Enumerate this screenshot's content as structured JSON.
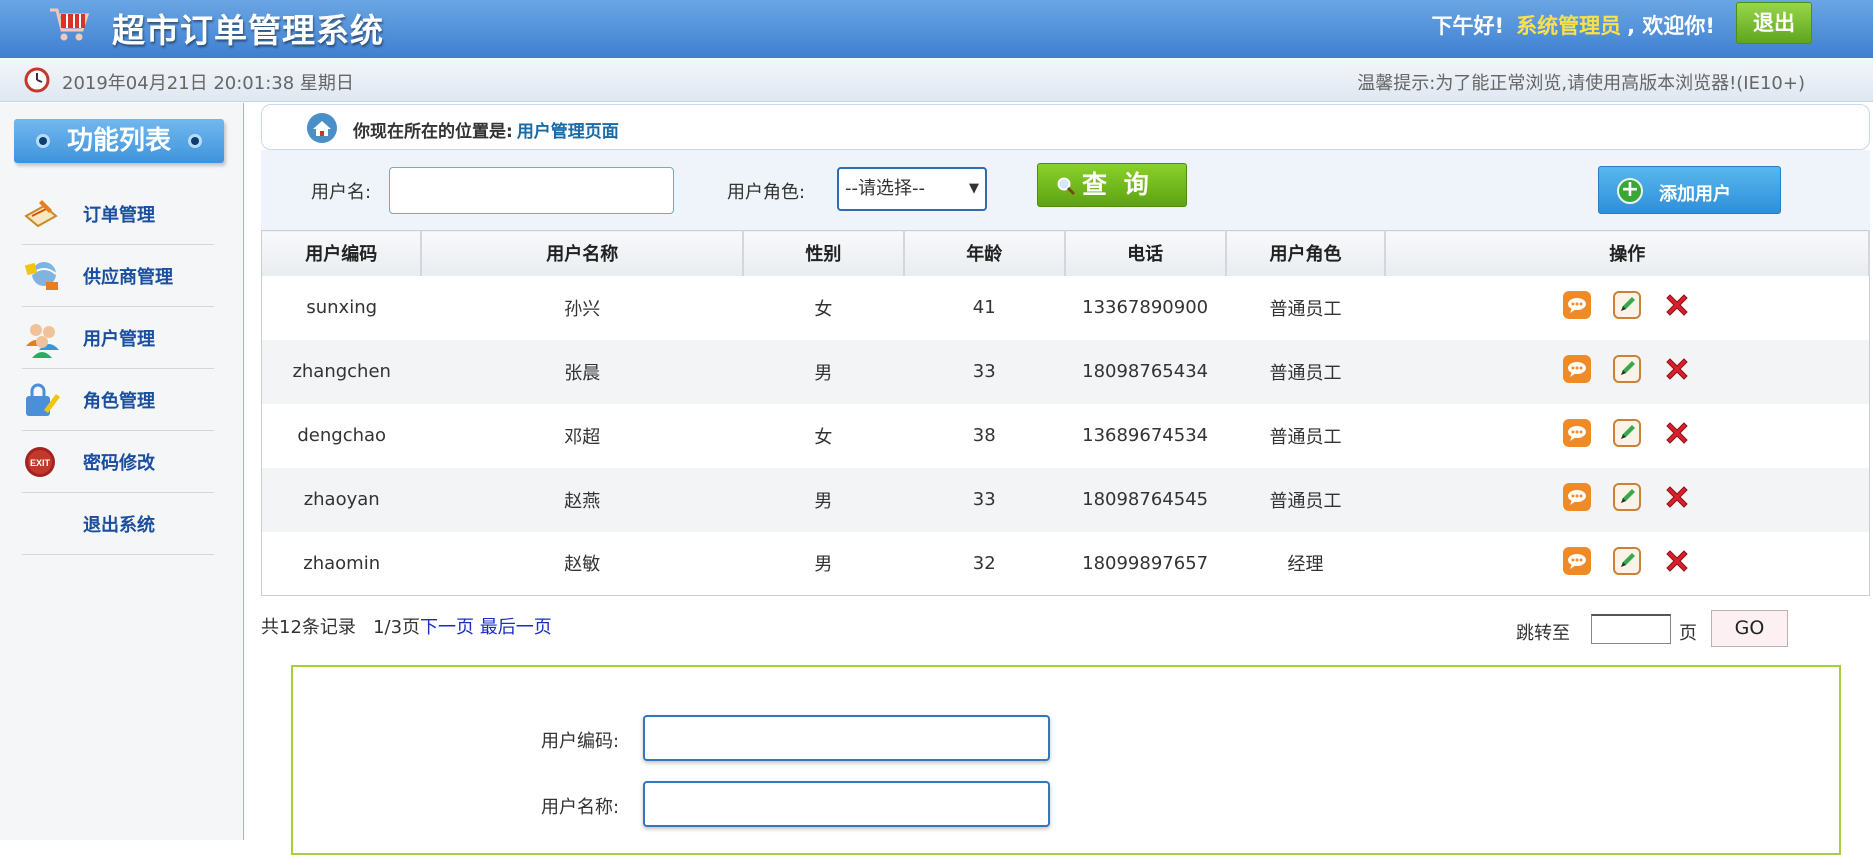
{
  "header": {
    "app_title": "超市订单管理系统",
    "greeting_prefix": "下午好!",
    "role": "系统管理员",
    "greeting_suffix": ", 欢迎你!",
    "logout": "退出"
  },
  "subbar": {
    "datetime": "2019年04月21日 20:01:38 星期日",
    "tip": "温馨提示:为了能正常浏览,请使用高版本浏览器!(IE10+)"
  },
  "sidebar": {
    "title": "功能列表",
    "items": [
      {
        "label": "订单管理",
        "icon": "order-icon"
      },
      {
        "label": "供应商管理",
        "icon": "supplier-icon"
      },
      {
        "label": "用户管理",
        "icon": "users-icon"
      },
      {
        "label": "角色管理",
        "icon": "role-icon"
      },
      {
        "label": "密码修改",
        "icon": "exit-badge-icon"
      },
      {
        "label": "退出系统",
        "icon": ""
      }
    ]
  },
  "breadcrumb": {
    "prefix": "你现在所在的位置是:",
    "page": "用户管理页面"
  },
  "search": {
    "username_label": "用户名:",
    "username_value": "",
    "role_label": "用户角色:",
    "role_selected": "--请选择--",
    "query_button": "查 询",
    "add_button": "添加用户"
  },
  "table": {
    "columns": [
      "用户编码",
      "用户名称",
      "性别",
      "年龄",
      "电话",
      "用户角色",
      "操作"
    ],
    "rows": [
      {
        "code": "sunxing",
        "name": "孙兴",
        "gender": "女",
        "age": "41",
        "phone": "13367890900",
        "role": "普通员工"
      },
      {
        "code": "zhangchen",
        "name": "张晨",
        "gender": "男",
        "age": "33",
        "phone": "18098765434",
        "role": "普通员工"
      },
      {
        "code": "dengchao",
        "name": "邓超",
        "gender": "女",
        "age": "38",
        "phone": "13689674534",
        "role": "普通员工"
      },
      {
        "code": "zhaoyan",
        "name": "赵燕",
        "gender": "男",
        "age": "33",
        "phone": "18098764545",
        "role": "普通员工"
      },
      {
        "code": "zhaomin",
        "name": "赵敏",
        "gender": "男",
        "age": "32",
        "phone": "18099897657",
        "role": "经理"
      }
    ]
  },
  "pager": {
    "total": "共12条记录",
    "current": "1/3页",
    "next": "下一页",
    "last": "最后一页",
    "jump_label": "跳转至",
    "jump_value": "",
    "page_unit": "页",
    "go": "GO"
  },
  "form": {
    "code_label": "用户编码:",
    "code_value": "",
    "name_label": "用户名称:",
    "name_value": ""
  },
  "colors": {
    "header_top": "#6aa6e4",
    "header_bottom": "#3f7fd0",
    "role_highlight": "#fde047",
    "menu_text": "#1a4fa0",
    "query_green": "#6bb51c",
    "add_blue": "#3a9be0",
    "form_border": "#a6cf3e"
  }
}
